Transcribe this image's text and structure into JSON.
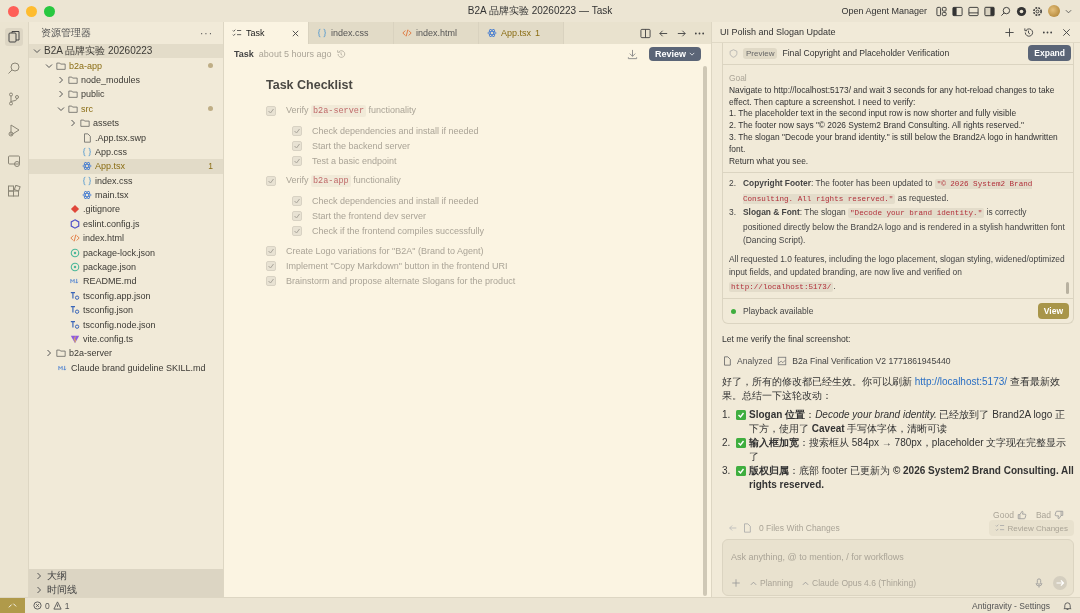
{
  "window": {
    "title": "B2A 品牌实验 20260223 — Task",
    "agent_manager": "Open Agent Manager"
  },
  "explorer": {
    "title": "资源管理器",
    "more": "···",
    "root": {
      "name": "B2A 品牌实验 20260223",
      "kind": "root",
      "expanded": true,
      "children": [
        {
          "name": "b2a-app",
          "kind": "folder",
          "expanded": true,
          "selected": false,
          "modified": true,
          "children": [
            {
              "name": "node_modules",
              "kind": "folder",
              "expanded": false,
              "selected": false,
              "modified": false
            },
            {
              "name": "public",
              "kind": "folder",
              "expanded": false,
              "selected": false,
              "modified": false
            },
            {
              "name": "src",
              "kind": "folder",
              "expanded": true,
              "selected": false,
              "modified": true,
              "children": [
                {
                  "name": "assets",
                  "kind": "folder",
                  "expanded": false,
                  "selected": false,
                  "modified": false
                },
                {
                  "name": ".App.tsx.swp",
                  "kind": "file",
                  "selected": false,
                  "modified": false
                },
                {
                  "name": "App.css",
                  "kind": "css",
                  "selected": false,
                  "modified": false
                },
                {
                  "name": "App.tsx",
                  "kind": "react",
                  "selected": true,
                  "modified": true,
                  "problems": "1"
                },
                {
                  "name": "index.css",
                  "kind": "css",
                  "selected": false,
                  "modified": false
                },
                {
                  "name": "main.tsx",
                  "kind": "react",
                  "selected": false,
                  "modified": false
                }
              ]
            },
            {
              "name": ".gitignore",
              "kind": "git",
              "selected": false,
              "modified": false
            },
            {
              "name": "eslint.config.js",
              "kind": "eslint",
              "selected": false,
              "modified": false
            },
            {
              "name": "index.html",
              "kind": "html",
              "selected": false,
              "modified": false
            },
            {
              "name": "package-lock.json",
              "kind": "json",
              "selected": false,
              "modified": false
            },
            {
              "name": "package.json",
              "kind": "json",
              "selected": false,
              "modified": false
            },
            {
              "name": "README.md",
              "kind": "markdown",
              "selected": false,
              "modified": false
            },
            {
              "name": "tsconfig.app.json",
              "kind": "tsconfig",
              "selected": false,
              "modified": false
            },
            {
              "name": "tsconfig.json",
              "kind": "tsconfig",
              "selected": false,
              "modified": false
            },
            {
              "name": "tsconfig.node.json",
              "kind": "tsconfig",
              "selected": false,
              "modified": false
            },
            {
              "name": "vite.config.ts",
              "kind": "vite",
              "selected": false,
              "modified": false
            }
          ]
        },
        {
          "name": "b2a-server",
          "kind": "folder",
          "expanded": false,
          "selected": false,
          "modified": false
        },
        {
          "name": "Claude brand guideline SKILL.md",
          "kind": "markdown",
          "selected": false,
          "modified": false
        }
      ]
    },
    "sections": [
      {
        "label": "大纲",
        "expanded": false
      },
      {
        "label": "时间线",
        "expanded": false
      }
    ]
  },
  "tabs": [
    {
      "label": "Task",
      "kind": "task",
      "selected": true,
      "modified": false
    },
    {
      "label": "index.css",
      "kind": "css",
      "selected": false,
      "modified": false
    },
    {
      "label": "index.html",
      "kind": "html",
      "selected": false,
      "modified": false
    },
    {
      "label": "App.tsx",
      "kind": "react",
      "selected": false,
      "modified": true,
      "problems": "1"
    }
  ],
  "task_header": {
    "title": "Task",
    "time": "about 5 hours ago",
    "review_button": "Review"
  },
  "checklist": {
    "title": "Task Checklist",
    "items": [
      {
        "checked": true,
        "segments": [
          {
            "kind": "text",
            "text": "Verify "
          },
          {
            "kind": "code",
            "text": "b2a-server"
          },
          {
            "kind": "text",
            "text": " functionality"
          }
        ],
        "children": [
          {
            "checked": true,
            "segments": [
              {
                "kind": "text",
                "text": "Check dependencies and install if needed"
              }
            ]
          },
          {
            "checked": true,
            "segments": [
              {
                "kind": "text",
                "text": "Start the backend server"
              }
            ]
          },
          {
            "checked": true,
            "segments": [
              {
                "kind": "text",
                "text": "Test a basic endpoint"
              }
            ]
          }
        ]
      },
      {
        "checked": true,
        "segments": [
          {
            "kind": "text",
            "text": "Verify "
          },
          {
            "kind": "code",
            "text": "b2a-app"
          },
          {
            "kind": "text",
            "text": " functionality"
          }
        ],
        "children": [
          {
            "checked": true,
            "segments": [
              {
                "kind": "text",
                "text": "Check dependencies and install if needed"
              }
            ]
          },
          {
            "checked": true,
            "segments": [
              {
                "kind": "text",
                "text": "Start the frontend dev server"
              }
            ]
          },
          {
            "checked": true,
            "segments": [
              {
                "kind": "text",
                "text": "Check if the frontend compiles successfully"
              }
            ]
          }
        ]
      },
      {
        "checked": true,
        "segments": [
          {
            "kind": "text",
            "text": "Create Logo variations for \"B2A\" (Brand to Agent)"
          }
        ]
      },
      {
        "checked": true,
        "segments": [
          {
            "kind": "text",
            "text": "Implement \"Copy Markdown\" button in the frontend URI"
          }
        ]
      },
      {
        "checked": true,
        "segments": [
          {
            "kind": "text",
            "text": "Brainstorm and propose alternate Slogans for the product"
          }
        ]
      }
    ]
  },
  "agent": {
    "title": "UI Polish and Slogan Update",
    "card": {
      "badge": "Preview",
      "title": "Final Copyright and Placeholder Verification",
      "expand_button": "Expand",
      "goal_label": "Goal",
      "goal_lines": [
        "Navigate to http://localhost:5173/ and wait 3 seconds for any hot-reload changes to take effect. Then capture a screenshot. I need to verify:",
        "1. The placeholder text in the second input row is now shorter and fully visible",
        "2. The footer now says \"© 2026 System2 Brand Consulting. All rights reserved.\"",
        "3. The slogan \"Decode your brand identity.\" is still below the Brand2A logo in handwritten font.",
        "Return what you see."
      ],
      "result_items": [
        {
          "number": "2.",
          "segments": [
            {
              "kind": "text",
              "text": "**Copyright Footer**: The footer has been updated to "
            },
            {
              "kind": "code",
              "text": "\"© 2026 System2 Brand Consulting. All rights reserved.\""
            },
            {
              "kind": "text",
              "text": " as requested."
            }
          ]
        },
        {
          "number": "3.",
          "segments": [
            {
              "kind": "text",
              "text": "**Slogan & Font**: The slogan "
            },
            {
              "kind": "code",
              "text": "\"Decode your brand identity.\""
            },
            {
              "kind": "text",
              "text": " is correctly positioned directly below the Brand2A logo and is rendered in a stylish handwritten font (Dancing Script)."
            }
          ]
        }
      ],
      "result_summary": [
        {
          "kind": "text",
          "text": "All requested 1.0 features, including the logo placement, slogan styling, widened/optimized input fields, and updated branding, are now live and verified on "
        },
        {
          "kind": "code",
          "text": "http://localhost:5173/"
        },
        {
          "kind": "text",
          "text": "."
        }
      ],
      "playback": "Playback available",
      "view_button": "View"
    },
    "verify_text": "Let me verify the final screenshot:",
    "analyzed": {
      "label": "Analyzed",
      "file": "B2a Final Verification V2 1771861945440"
    },
    "reply": [
      {
        "kind": "text",
        "text": "好了，所有的修改都已经生效。你可以刷新 "
      },
      {
        "kind": "link",
        "text": "http://localhost:5173/"
      },
      {
        "kind": "text",
        "text": " 查看最新效果。总结一下这轮改动："
      }
    ],
    "reply_items": [
      {
        "number": "1.",
        "text": "**Slogan 位置**：*Decode your brand identity.* 已经放到了 Brand2A logo 正下方，使用了 **Caveat** 手写体字体，清晰可读"
      },
      {
        "number": "2.",
        "text": "**输入框加宽**：搜索框从 584px → 780px，placeholder 文字现在完整显示了"
      },
      {
        "number": "3.",
        "text": "**版权归属**：底部 footer 已更新为 **© 2026 System2 Brand Consulting. All rights reserved.**"
      }
    ],
    "feedback": {
      "good": "Good",
      "bad": "Bad"
    },
    "files_changed": "0 Files With Changes",
    "review_changes": "Review Changes",
    "input": {
      "placeholder": "Ask anything, @ to mention, / for workflows",
      "mode": "Planning",
      "model": "Claude Opus 4.6 (Thinking)"
    }
  },
  "status_bar": {
    "errors": "0",
    "warnings": "1",
    "settings": "Antigravity - Settings"
  }
}
